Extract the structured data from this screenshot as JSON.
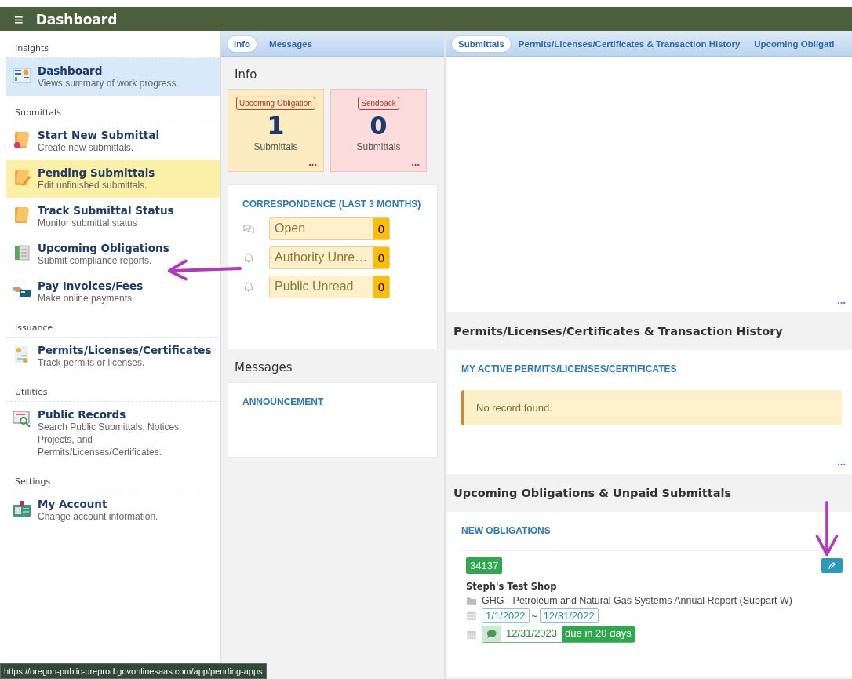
{
  "header": {
    "menu_glyph": "≡",
    "title": "Dashboard"
  },
  "sidebar": {
    "sections": [
      {
        "heading": "Insights",
        "items": [
          {
            "kind": "dashboard",
            "title": "Dashboard",
            "subtitle": "Views summary of work progress.",
            "selected": true,
            "hovered": false
          }
        ]
      },
      {
        "heading": "Submittals",
        "items": [
          {
            "kind": "new",
            "title": "Start New Submittal",
            "subtitle": "Create new submittals.",
            "selected": false,
            "hovered": false
          },
          {
            "kind": "edit",
            "title": "Pending Submittals",
            "subtitle": "Edit unfinished submittals.",
            "selected": false,
            "hovered": true
          },
          {
            "kind": "track",
            "title": "Track Submittal Status",
            "subtitle": "Monitor submittal status",
            "selected": false,
            "hovered": false
          },
          {
            "kind": "obligation",
            "title": "Upcoming Obligations",
            "subtitle": "Submit compliance reports.",
            "selected": false,
            "hovered": false
          },
          {
            "kind": "pay",
            "title": "Pay Invoices/Fees",
            "subtitle": "Make online payments.",
            "selected": false,
            "hovered": false
          }
        ]
      },
      {
        "heading": "Issuance",
        "items": [
          {
            "kind": "permit",
            "title": "Permits/Licenses/Certificates",
            "subtitle": "Track permits or licenses.",
            "selected": false,
            "hovered": false
          }
        ]
      },
      {
        "heading": "Utilities",
        "items": [
          {
            "kind": "records",
            "title": "Public Records",
            "subtitle": "Search Public Submittals, Notices, Projects, and Permits/Licenses/Certificates.",
            "selected": false,
            "hovered": false
          }
        ]
      },
      {
        "heading": "Settings",
        "items": [
          {
            "kind": "account",
            "title": "My Account",
            "subtitle": "Change account information.",
            "selected": false,
            "hovered": false
          }
        ]
      }
    ]
  },
  "middle": {
    "tabs": [
      {
        "label": "Info",
        "selected": true
      },
      {
        "label": "Messages",
        "selected": false
      }
    ],
    "info_heading": "Info",
    "cards": [
      {
        "kind": "warning",
        "badge": "Upcoming Obligation",
        "count": "1",
        "label": "Submittals",
        "more": "..."
      },
      {
        "kind": "danger",
        "badge": "Sendback",
        "count": "0",
        "label": "Submittals",
        "more": "..."
      }
    ],
    "correspondence": {
      "title": "CORRESPONDENCE (LAST 3 MONTHS)",
      "rows": [
        {
          "kind": "chat",
          "label": "Open",
          "count": "0"
        },
        {
          "kind": "bell",
          "label": "Authority Unre…",
          "count": "0"
        },
        {
          "kind": "bell",
          "label": "Public Unread",
          "count": "0"
        }
      ]
    },
    "messages_heading": "Messages",
    "announcement_title": "ANNOUNCEMENT"
  },
  "right": {
    "tabs": [
      {
        "label": "Submittals",
        "selected": true
      },
      {
        "label": "Permits/Licenses/Certificates & Transaction History",
        "selected": false
      },
      {
        "label": "Upcoming Obligati",
        "selected": false
      }
    ],
    "submittals_more": "...",
    "permits": {
      "heading": "Permits/Licenses/Certificates & Transaction History",
      "card_title": "MY ACTIVE PERMITS/LICENSES/CERTIFICATES",
      "alert": "No record found.",
      "more": "..."
    },
    "obligations": {
      "heading": "Upcoming Obligations & Unpaid Submittals",
      "card_title": "NEW OBLIGATIONS",
      "item": {
        "id": "34137",
        "name": "Steph's Test Shop",
        "report": "GHG - Petroleum and Natural Gas Systems Annual Report (Subpart W)",
        "start": "1/1/2022",
        "separator": "~",
        "end": "12/31/2022",
        "due": "12/31/2023",
        "due_note": "due in 20 days"
      }
    }
  },
  "status_url": "https://oregon-public-preprod.govonlinesaas.com/app/pending-apps"
}
